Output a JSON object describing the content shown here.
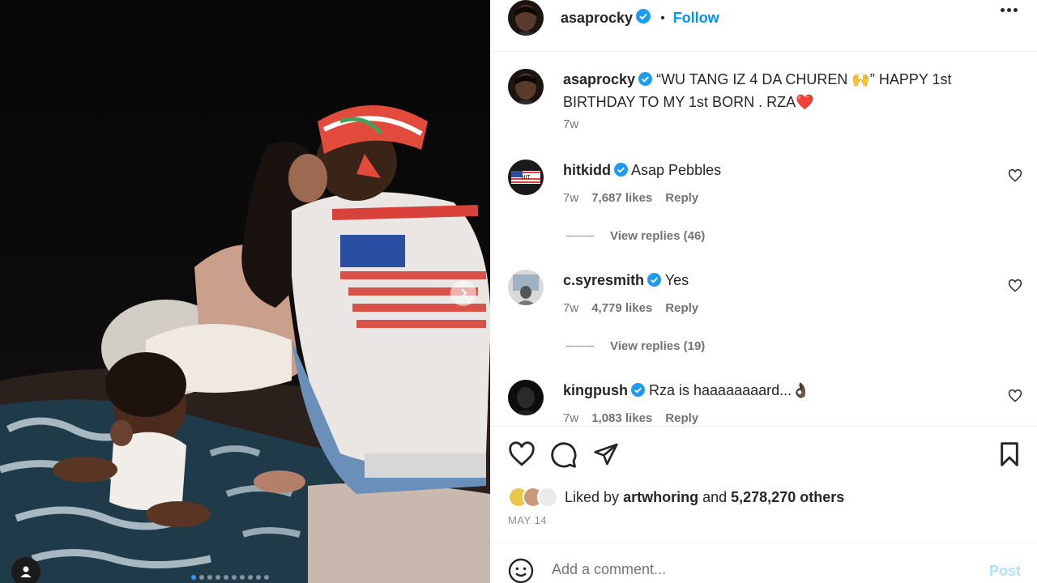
{
  "post": {
    "author": "asaprocky",
    "follow_label": "Follow",
    "separator": "•",
    "caption": "“WU TANG IZ 4 DA CHUREN 🙌” HAPPY 1st BIRTHDAY TO MY 1st BORN . RZA❤️",
    "caption_age": "7w"
  },
  "comments": [
    {
      "user": "hitkidd",
      "text": "Asap Pebbles",
      "age": "7w",
      "likes": "7,687 likes",
      "reply": "Reply",
      "view_replies": "View replies (46)"
    },
    {
      "user": "c.syresmith",
      "text": "Yes",
      "age": "7w",
      "likes": "4,779 likes",
      "reply": "Reply",
      "view_replies": "View replies (19)"
    },
    {
      "user": "kingpush",
      "text": "Rza is haaaaaaaard...👌🏿",
      "age": "7w",
      "likes": "1,083 likes",
      "reply": "Reply"
    }
  ],
  "likes": {
    "prefix": "Liked by",
    "user": "artwhoring",
    "conjunction": "and",
    "others": "5,278,270 others"
  },
  "date": "MAY 14",
  "comment_box": {
    "placeholder": "Add a comment...",
    "post_label": "Post"
  },
  "carousel": {
    "slide_count": 10,
    "current": 1
  },
  "colors": {
    "accent": "#0095f6",
    "verified": "#1d9bf0",
    "post_disabled": "#b2dffc"
  },
  "icons": [
    "verified-badge-icon",
    "more-options-icon",
    "heart-icon",
    "comment-icon",
    "share-icon",
    "bookmark-icon",
    "emoji-icon",
    "next-arrow-icon",
    "user-tag-icon"
  ]
}
